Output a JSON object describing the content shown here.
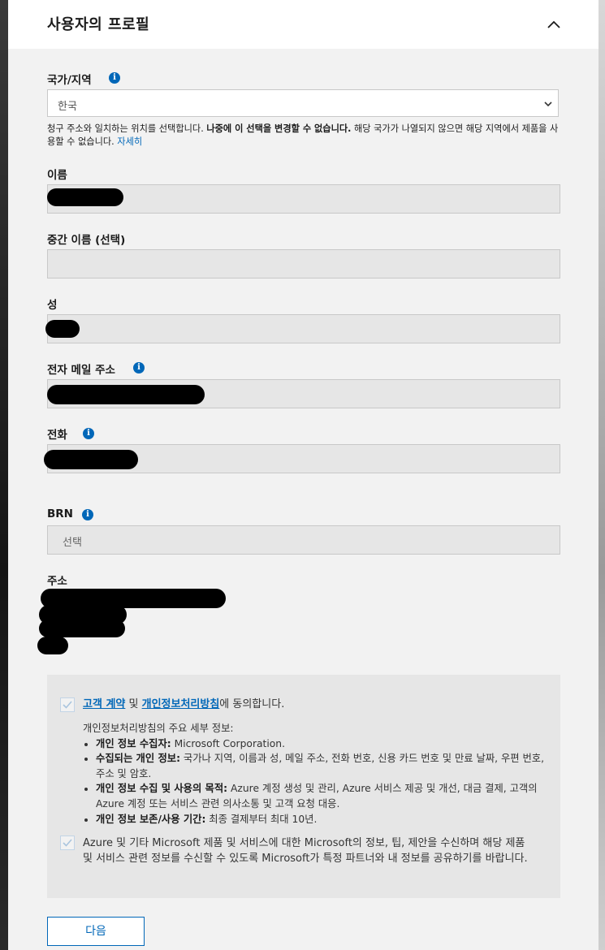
{
  "header": {
    "title": "사용자의 프로필"
  },
  "country": {
    "label": "국가/지역",
    "selected": "한국",
    "help_prefix": "청구 주소와 일치하는 위치를 선택합니다. ",
    "help_bold": "나중에 이 선택을 변경할 수 없습니다.",
    "help_suffix": " 해당 국가가 나열되지 않으면 해당 지역에서 제품을 사용할 수 없습니다. ",
    "help_link": "자세히"
  },
  "fields": {
    "first_name": {
      "label": "이름"
    },
    "middle_name": {
      "label": "중간 이름 (선택)"
    },
    "last_name": {
      "label": "성"
    },
    "email": {
      "label": "전자 메일 주소"
    },
    "phone": {
      "label": "전화"
    },
    "brn": {
      "label": "BRN",
      "placeholder": "선택"
    },
    "address": {
      "label": "주소"
    }
  },
  "consent": {
    "link1": "고객 계약",
    "connector": " 및 ",
    "link2": "개인정보처리방침",
    "suffix": "에 동의합니다.",
    "details_intro": "개인정보처리방침의 주요 세부 정보:",
    "items": [
      {
        "bold": "개인 정보 수집자:",
        "text": " Microsoft Corporation."
      },
      {
        "bold": "수집되는 개인 정보:",
        "text": " 국가나 지역, 이름과 성, 메일 주소, 전화 번호, 신용 카드 번호 및 만료 날짜, 우편 번호, 주소 및 암호."
      },
      {
        "bold": "개인 정보 수집 및 사용의 목적:",
        "text": " Azure 계정 생성 및 관리, Azure 서비스 제공 및 개선, 대금 결제, 고객의 Azure 계정 또는 서비스 관련 의사소통 및 고객 요청 대응."
      },
      {
        "bold": "개인 정보 보존/사용 기간:",
        "text": " 최종 결제부터 최대 10년."
      }
    ],
    "marketing": "Azure 및 기타 Microsoft 제품 및 서비스에 대한 Microsoft의 정보, 팁, 제안을 수신하며 해당 제품 및 서비스 관련 정보를 수신할 수 있도록 Microsoft가 특정 파트너와 내 정보를 공유하기를 바랍니다."
  },
  "actions": {
    "next": "다음"
  },
  "colors": {
    "accent": "#0067b8",
    "panel": "#f2f2f2",
    "field": "#e6e6e6"
  }
}
